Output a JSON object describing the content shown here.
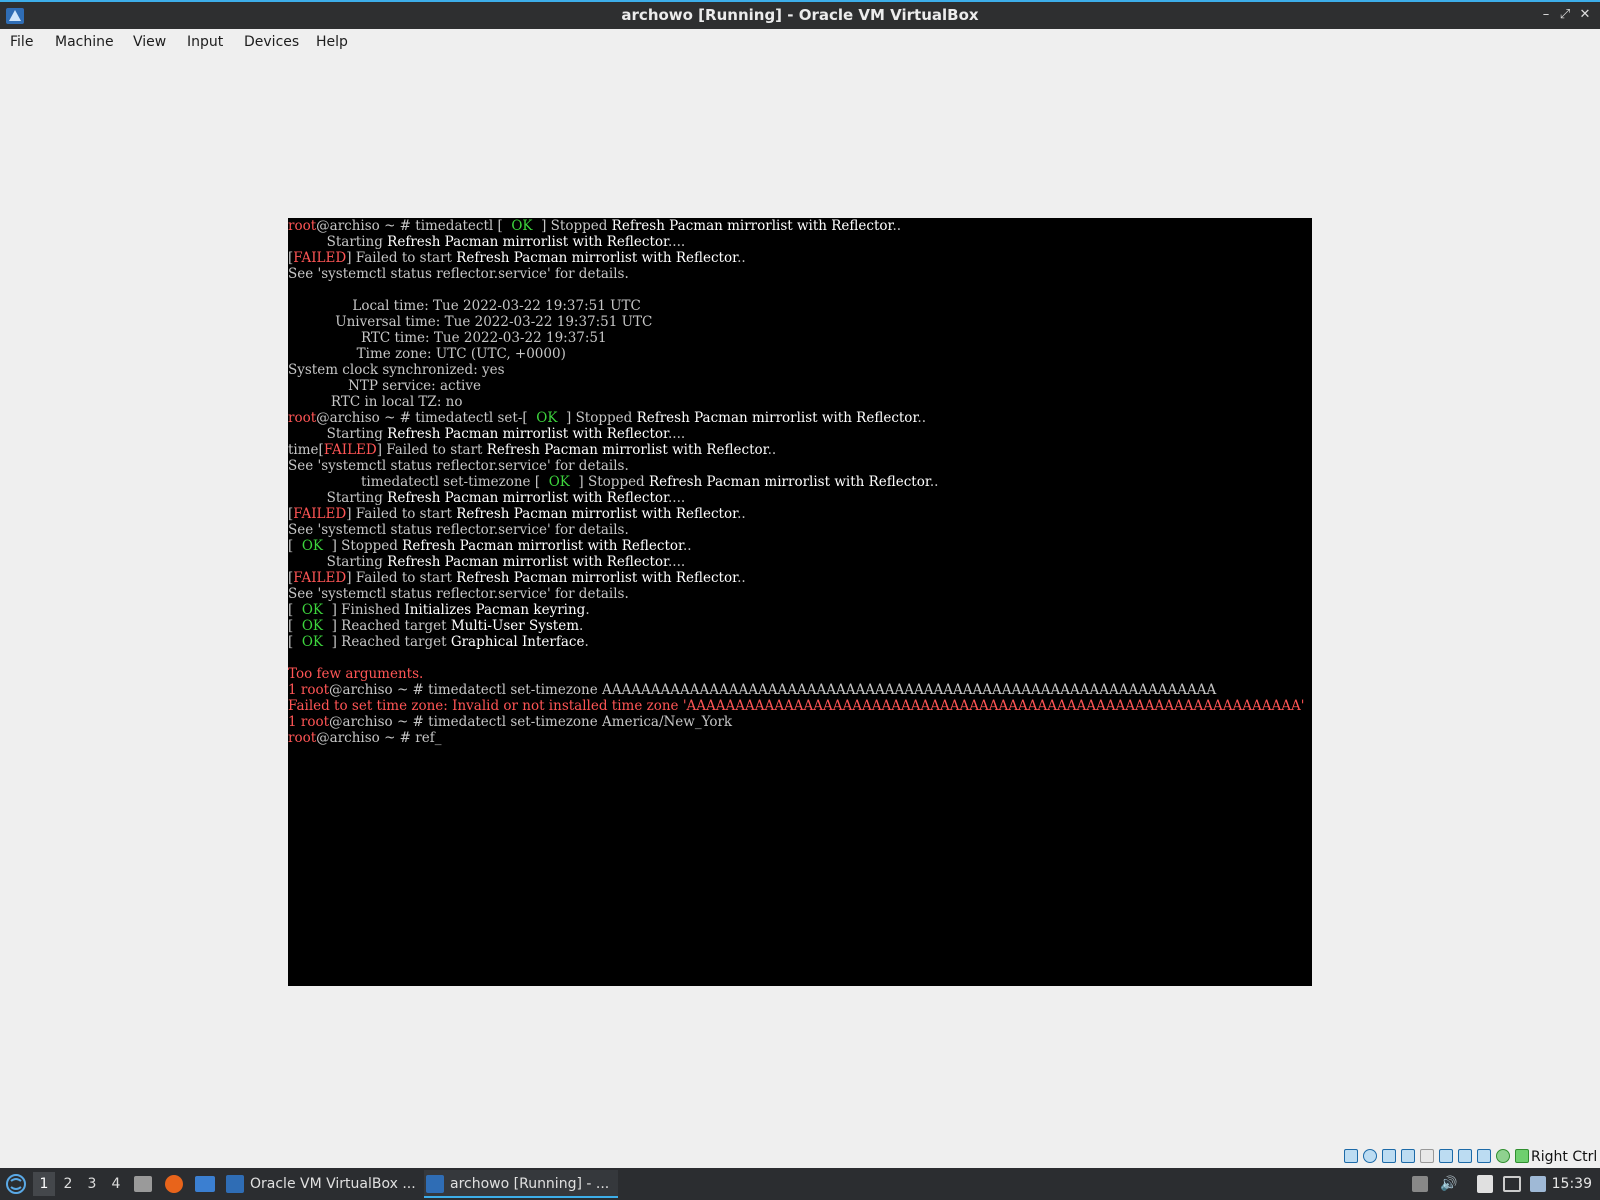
{
  "window": {
    "title": "archowo [Running] - Oracle VM VirtualBox",
    "minimize_icon": "minimize-icon",
    "maximize_icon": "maximize-icon",
    "close_icon": "close-icon"
  },
  "menubar": {
    "items": [
      "File",
      "Machine",
      "View",
      "Input",
      "Devices",
      "Help"
    ]
  },
  "terminal": {
    "lines": [
      [
        {
          "c": "r",
          "t": "root"
        },
        {
          "t": "@archiso ~ # timedatectl [  "
        },
        {
          "c": "g",
          "t": "OK"
        },
        {
          "t": "  ] Stopped "
        },
        {
          "c": "w",
          "t": "Refresh Pacman mirrorlist with Reflector"
        },
        {
          "t": ".."
        }
      ],
      [
        {
          "t": "         Starting "
        },
        {
          "c": "w",
          "t": "Refresh Pacman mirrorlist with Reflector"
        },
        {
          "t": "...."
        }
      ],
      [
        {
          "t": "["
        },
        {
          "c": "r",
          "t": "FAILED"
        },
        {
          "t": "] Failed to start "
        },
        {
          "c": "w",
          "t": "Refresh Pacman mirrorlist with Reflector"
        },
        {
          "t": ".."
        }
      ],
      [
        {
          "t": "See 'systemctl status reflector.service' for details."
        }
      ],
      [
        {
          "t": ""
        }
      ],
      [
        {
          "t": "               Local time: Tue 2022-03-22 19:37:51 UTC"
        }
      ],
      [
        {
          "t": "           Universal time: Tue 2022-03-22 19:37:51 UTC"
        }
      ],
      [
        {
          "t": "                 RTC time: Tue 2022-03-22 19:37:51"
        }
      ],
      [
        {
          "t": "                Time zone: UTC (UTC, +0000)"
        }
      ],
      [
        {
          "t": "System clock synchronized: yes"
        }
      ],
      [
        {
          "t": "              NTP service: active"
        }
      ],
      [
        {
          "t": "          RTC in local TZ: no"
        }
      ],
      [
        {
          "c": "r",
          "t": "root"
        },
        {
          "t": "@archiso ~ # timedatectl set-[  "
        },
        {
          "c": "g",
          "t": "OK"
        },
        {
          "t": "  ] Stopped "
        },
        {
          "c": "w",
          "t": "Refresh Pacman mirrorlist with Reflector"
        },
        {
          "t": ".."
        }
      ],
      [
        {
          "t": "         Starting "
        },
        {
          "c": "w",
          "t": "Refresh Pacman mirrorlist with Reflector"
        },
        {
          "t": "...."
        }
      ],
      [
        {
          "t": "time["
        },
        {
          "c": "r",
          "t": "FAILED"
        },
        {
          "t": "] Failed to start "
        },
        {
          "c": "w",
          "t": "Refresh Pacman mirrorlist with Reflector"
        },
        {
          "t": ".."
        }
      ],
      [
        {
          "t": "See 'systemctl status reflector.service' for details."
        }
      ],
      [
        {
          "t": "                 timedatectl set-timezone [  "
        },
        {
          "c": "g",
          "t": "OK"
        },
        {
          "t": "  ] Stopped "
        },
        {
          "c": "w",
          "t": "Refresh Pacman mirrorlist with Reflector"
        },
        {
          "t": ".."
        }
      ],
      [
        {
          "t": "         Starting "
        },
        {
          "c": "w",
          "t": "Refresh Pacman mirrorlist with Reflector"
        },
        {
          "t": "...."
        }
      ],
      [
        {
          "t": "["
        },
        {
          "c": "r",
          "t": "FAILED"
        },
        {
          "t": "] Failed to start "
        },
        {
          "c": "w",
          "t": "Refresh Pacman mirrorlist with Reflector"
        },
        {
          "t": ".."
        }
      ],
      [
        {
          "t": "See 'systemctl status reflector.service' for details."
        }
      ],
      [
        {
          "t": "[  "
        },
        {
          "c": "g",
          "t": "OK"
        },
        {
          "t": "  ] Stopped "
        },
        {
          "c": "w",
          "t": "Refresh Pacman mirrorlist with Reflector"
        },
        {
          "t": ".."
        }
      ],
      [
        {
          "t": "         Starting "
        },
        {
          "c": "w",
          "t": "Refresh Pacman mirrorlist with Reflector"
        },
        {
          "t": "...."
        }
      ],
      [
        {
          "t": "["
        },
        {
          "c": "r",
          "t": "FAILED"
        },
        {
          "t": "] Failed to start "
        },
        {
          "c": "w",
          "t": "Refresh Pacman mirrorlist with Reflector"
        },
        {
          "t": ".."
        }
      ],
      [
        {
          "t": "See 'systemctl status reflector.service' for details."
        }
      ],
      [
        {
          "t": "[  "
        },
        {
          "c": "g",
          "t": "OK"
        },
        {
          "t": "  ] Finished "
        },
        {
          "c": "w",
          "t": "Initializes Pacman keyring"
        },
        {
          "t": "."
        }
      ],
      [
        {
          "t": "[  "
        },
        {
          "c": "g",
          "t": "OK"
        },
        {
          "t": "  ] Reached target "
        },
        {
          "c": "w",
          "t": "Multi-User System"
        },
        {
          "t": "."
        }
      ],
      [
        {
          "t": "[  "
        },
        {
          "c": "g",
          "t": "OK"
        },
        {
          "t": "  ] Reached target "
        },
        {
          "c": "w",
          "t": "Graphical Interface"
        },
        {
          "t": "."
        }
      ],
      [
        {
          "t": ""
        }
      ],
      [
        {
          "c": "r",
          "t": "Too few arguments."
        }
      ],
      [
        {
          "c": "r",
          "t": "1 root"
        },
        {
          "t": "@archiso ~ # timedatectl set-timezone AAAAAAAAAAAAAAAAAAAAAAAAAAAAAAAAAAAAAAAAAAAAAAAAAAAAAAAAAAAAAAA"
        }
      ],
      [
        {
          "c": "r",
          "t": "Failed to set time zone: Invalid or not installed time zone 'AAAAAAAAAAAAAAAAAAAAAAAAAAAAAAAAAAAAAAAAAAAAAAAAAAAAAAAAAAAAAAA'"
        }
      ],
      [
        {
          "c": "r",
          "t": "1 root"
        },
        {
          "t": "@archiso ~ # timedatectl set-timezone America/New_York"
        }
      ],
      [
        {
          "c": "r",
          "t": "root"
        },
        {
          "t": "@archiso ~ # ref_"
        }
      ]
    ]
  },
  "statusbar": {
    "host_key": "Right Ctrl",
    "icons": [
      "hard-disk-icon",
      "optical-drive-icon",
      "usb-icon",
      "shared-folder-icon",
      "display-icon",
      "network-icon",
      "recording-icon",
      "cpu-icon",
      "guest-additions-icon",
      "mouse-integration-icon"
    ]
  },
  "taskbar": {
    "workspaces": [
      "1",
      "2",
      "3",
      "4"
    ],
    "tasks": [
      {
        "label": "Oracle VM VirtualBox ..."
      },
      {
        "label": "archowo [Running] - ..."
      }
    ],
    "clock": "15:39"
  }
}
